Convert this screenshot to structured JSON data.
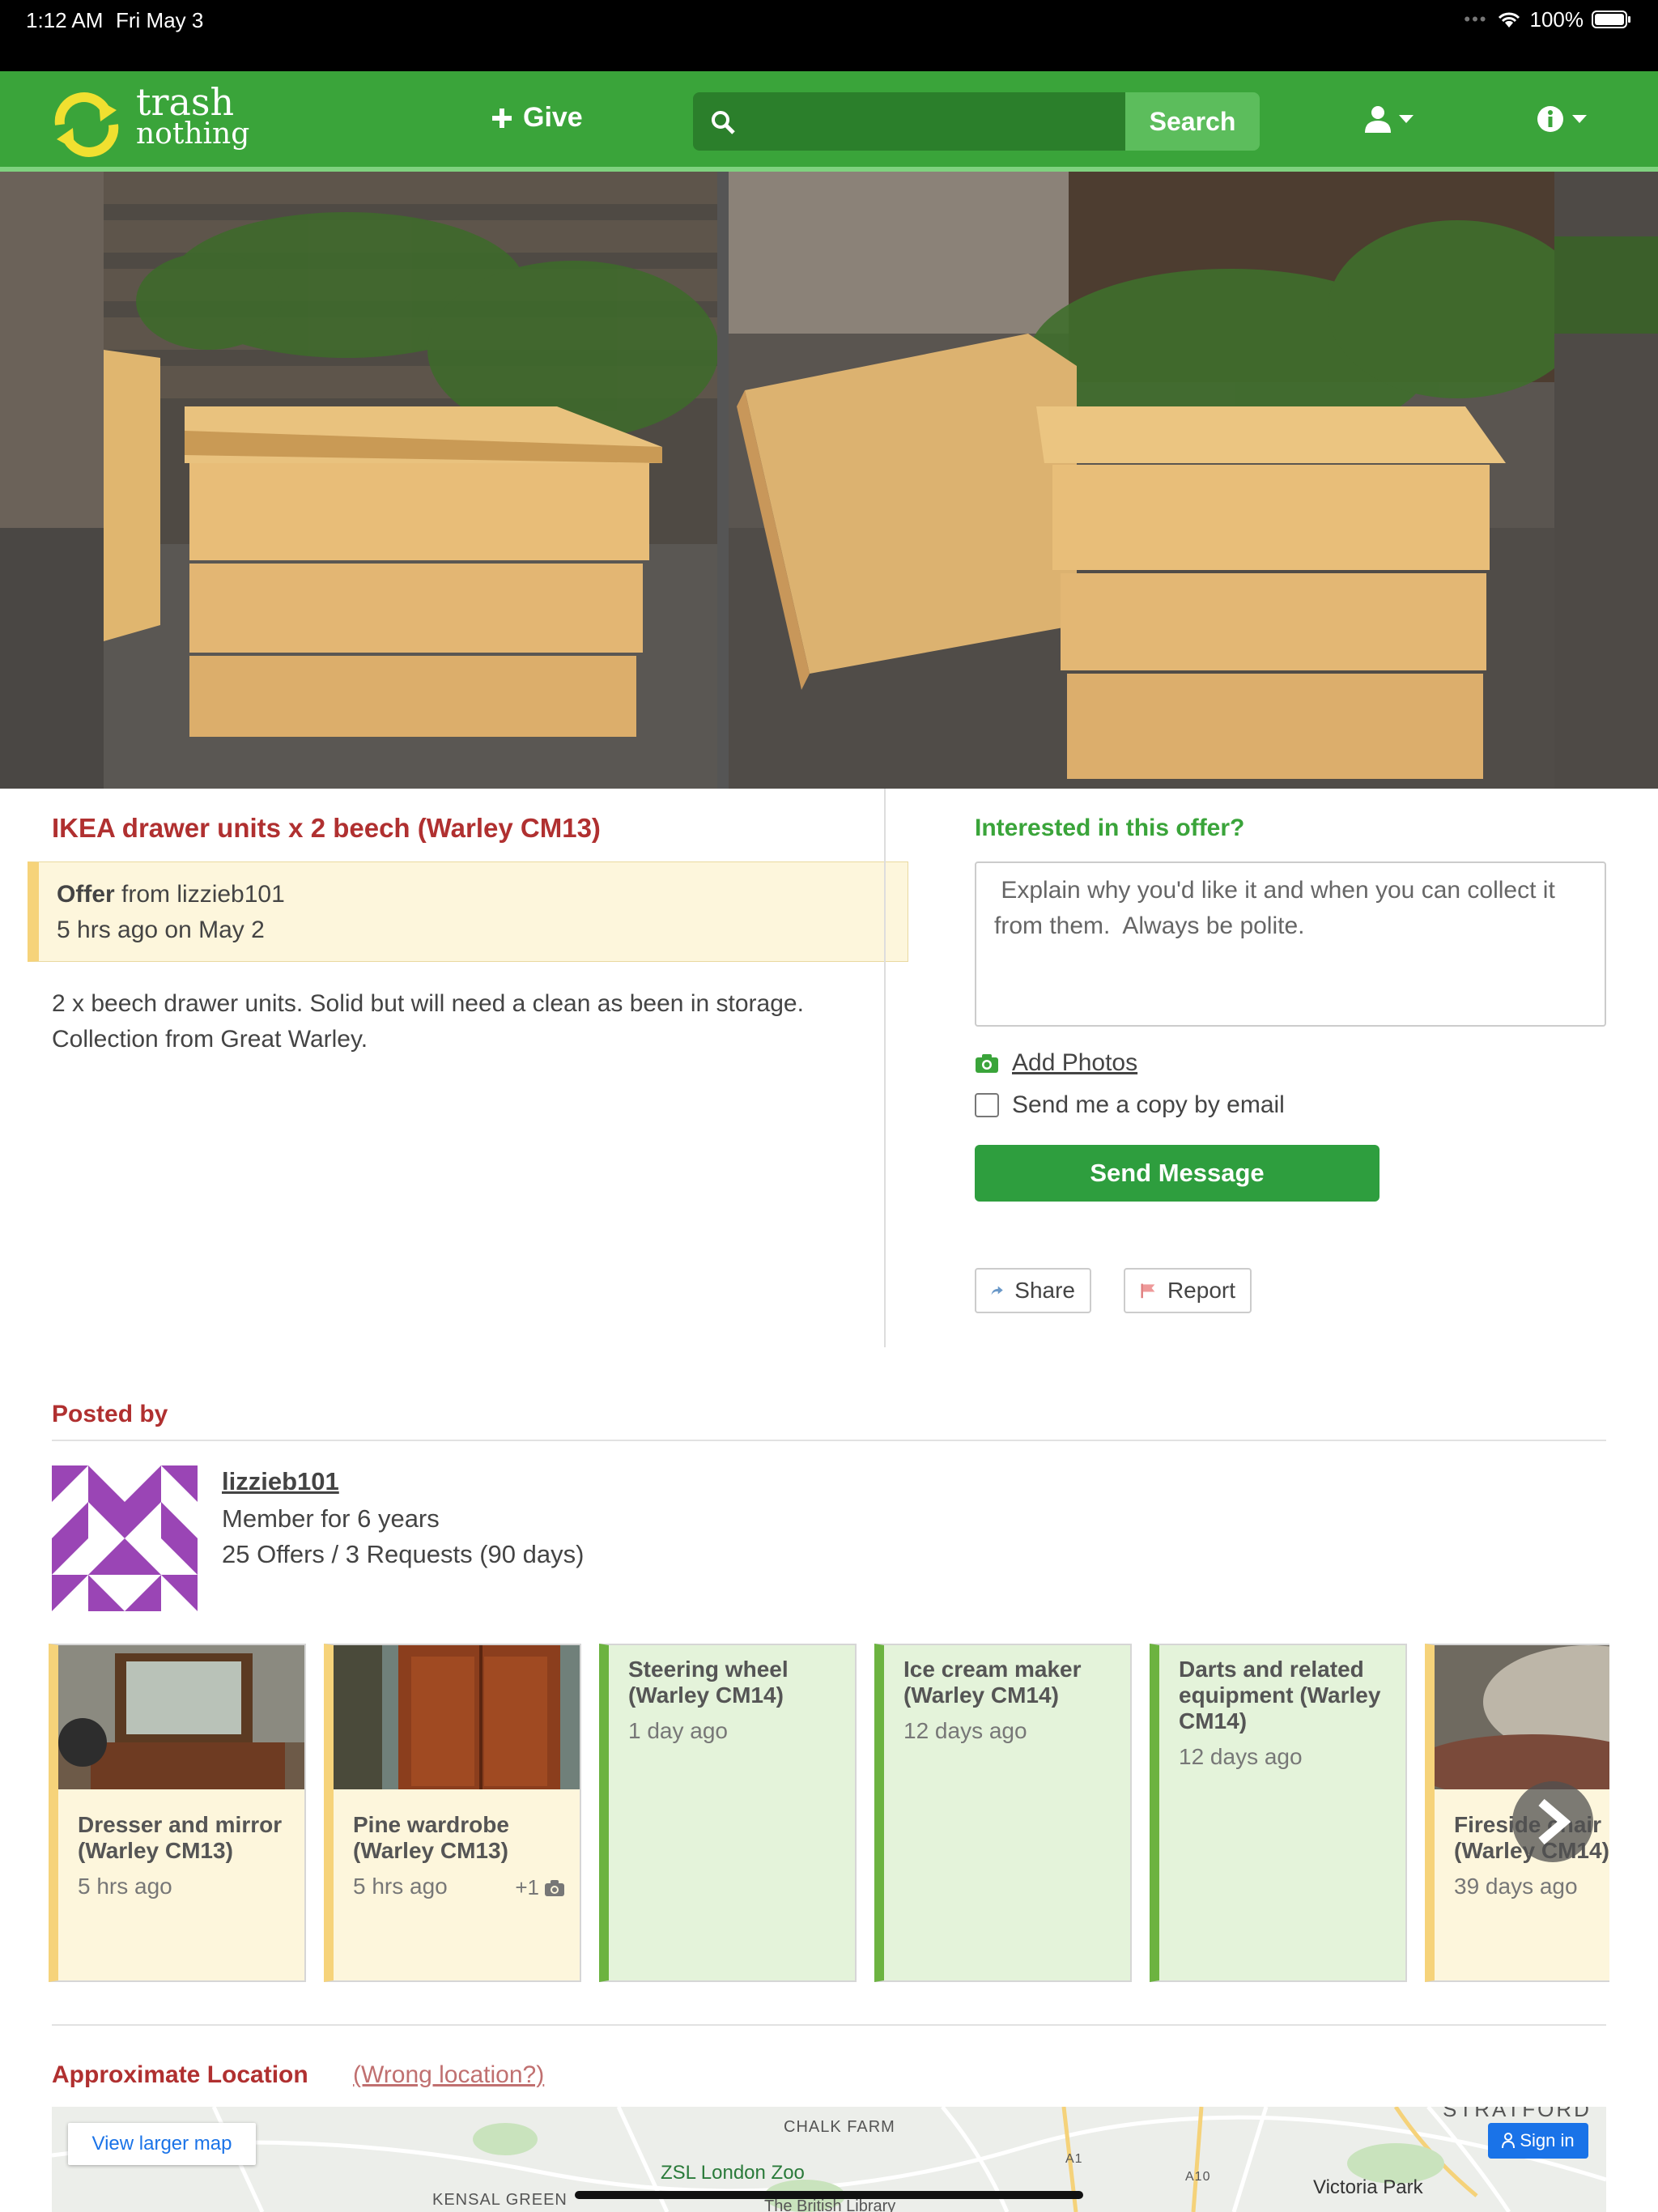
{
  "status_bar": {
    "time": "1:12 AM",
    "date": "Fri May 3",
    "battery": "100%"
  },
  "nav": {
    "logo_line1": "trash",
    "logo_line2": "nothing",
    "give_label": "Give",
    "search_placeholder": "",
    "search_button": "Search",
    "brand_color": "#3aa43a"
  },
  "post": {
    "title": "IKEA drawer units x 2 beech (Warley CM13)",
    "type_label": "Offer",
    "from_text": "from lizzieb101",
    "time_text": "5 hrs ago on May 2",
    "description_line1": "2 x beech drawer units. Solid but will need a clean as been in storage.",
    "description_line2": "Collection from Great Warley."
  },
  "reply": {
    "heading": "Interested in this offer?",
    "placeholder": " Explain why you'd like it and when you can collect it from them.  Always be polite.",
    "add_photos": "Add Photos",
    "email_copy": "Send me a copy by email",
    "send_button": "Send Message",
    "share": "Share",
    "report": "Report"
  },
  "poster": {
    "heading": "Posted by",
    "username": "lizzieb101",
    "member_for": "Member for 6 years",
    "stats": "25 Offers / 3 Requests (90 days)"
  },
  "other_posts": [
    {
      "title": "Dresser and mirror (Warley CM13)",
      "age": "5 hrs ago",
      "kind": "offer",
      "has_photo": true,
      "extra": ""
    },
    {
      "title": "Pine wardrobe (Warley CM13)",
      "age": "5 hrs ago",
      "kind": "offer",
      "has_photo": true,
      "extra": "+1"
    },
    {
      "title": "Steering wheel (Warley CM14)",
      "age": "1 day ago",
      "kind": "wanted",
      "has_photo": false,
      "extra": ""
    },
    {
      "title": "Ice cream maker (Warley CM14)",
      "age": "12 days ago",
      "kind": "wanted",
      "has_photo": false,
      "extra": ""
    },
    {
      "title": "Darts and related equipment (Warley CM14)",
      "age": "12 days ago",
      "kind": "wanted",
      "has_photo": false,
      "extra": ""
    },
    {
      "title": "Fireside chair (Warley CM14)",
      "age": "39 days ago",
      "kind": "offer",
      "has_photo": true,
      "extra": ""
    }
  ],
  "location": {
    "heading": "Approximate Location",
    "wrong_link": "(Wrong location?)",
    "view_larger": "View larger map",
    "sign_in": "Sign in",
    "map_labels": [
      "CHALK FARM",
      "ZSL London Zoo",
      "KENSAL GREEN",
      "STRATFORD",
      "Victoria Park",
      "A1",
      "A10",
      "The British Library"
    ]
  }
}
